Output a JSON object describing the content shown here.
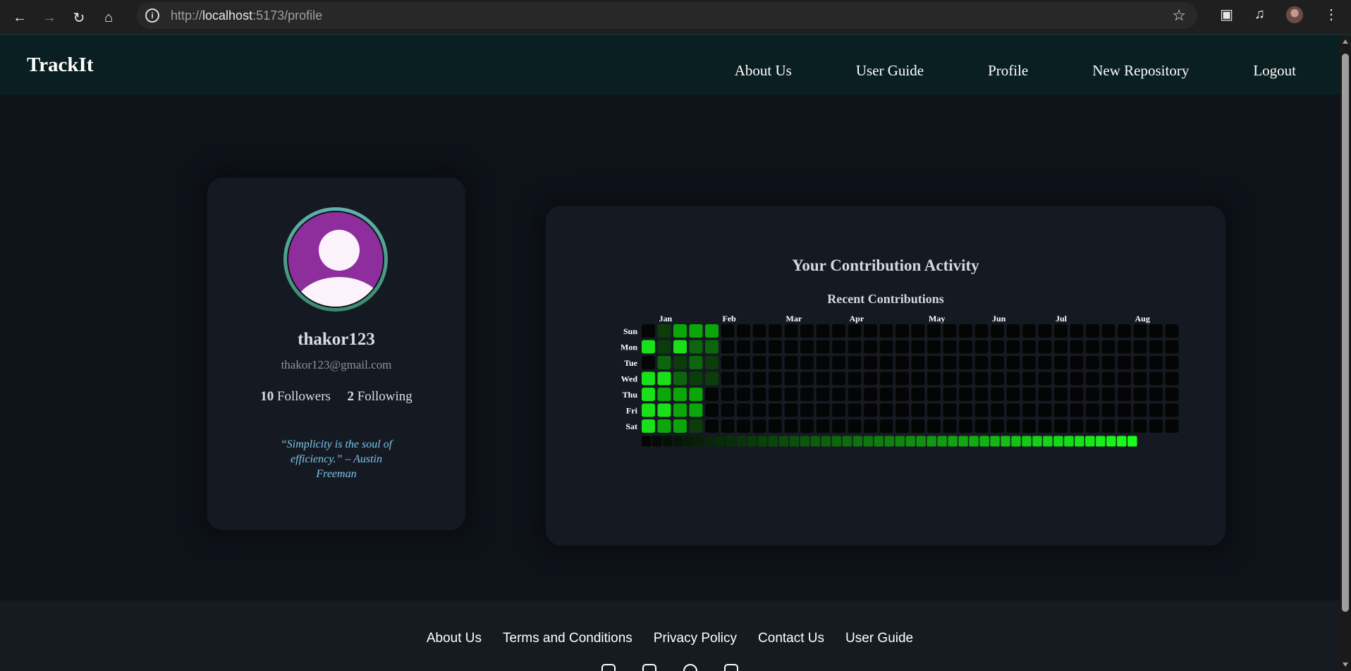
{
  "browser": {
    "url_prefix": "http://",
    "url_host": "localhost",
    "url_rest": ":5173/profile"
  },
  "header": {
    "brand": "TrackIt",
    "nav": [
      "About Us",
      "User Guide",
      "Profile",
      "New Repository",
      "Logout"
    ]
  },
  "profile": {
    "username": "thakor123",
    "email": "thakor123@gmail.com",
    "followers_count": "10",
    "followers_label": "Followers",
    "following_count": "2",
    "following_label": "Following",
    "quote": "“Simplicity is the soul of efficiency.” – Austin Freeman"
  },
  "activity": {
    "title": "Your Contribution Activity",
    "subtitle": "Recent Contributions"
  },
  "chart_data": {
    "type": "heatmap",
    "title": "Recent Contributions",
    "months": [
      "Jan",
      "Feb",
      "Mar",
      "Apr",
      "May",
      "Jun",
      "Jul",
      "Aug"
    ],
    "month_week_index": [
      1,
      5,
      9,
      13,
      18,
      22,
      26,
      31
    ],
    "days": [
      "Sun",
      "Mon",
      "Tue",
      "Wed",
      "Thu",
      "Fri",
      "Sat"
    ],
    "weeks": 34,
    "levels_by_week": [
      [
        0,
        4,
        0,
        4,
        4,
        4,
        4
      ],
      [
        1,
        1,
        2,
        4,
        3,
        4,
        3
      ],
      [
        3,
        4,
        1,
        2,
        3,
        3,
        3
      ],
      [
        3,
        2,
        2,
        1,
        3,
        3,
        1
      ],
      [
        3,
        2,
        1,
        1,
        0,
        0,
        0
      ]
    ],
    "level_colors": [
      "#050505",
      "#0b3d0b",
      "#0d660d",
      "#0aa60a",
      "#19e019"
    ],
    "legend_steps": 47,
    "legend_colors": [
      "#050505",
      "#19ff19"
    ]
  },
  "footer": {
    "links": [
      "About Us",
      "Terms and Conditions",
      "Privacy Policy",
      "Contact Us",
      "User Guide"
    ],
    "socials": [
      "instagram-icon",
      "linkedin-icon",
      "facebook-icon",
      "youtube-icon"
    ]
  }
}
